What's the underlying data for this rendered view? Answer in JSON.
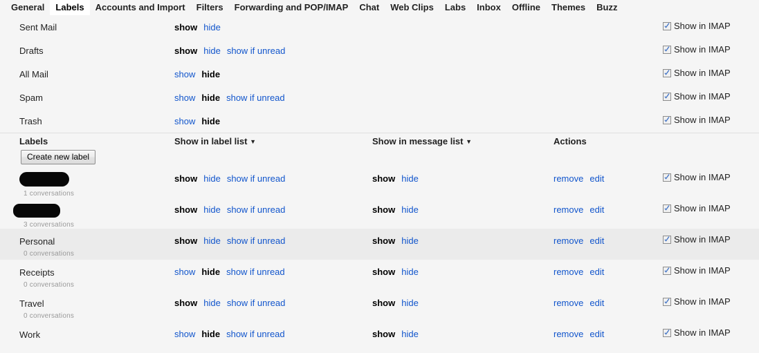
{
  "tabs": [
    {
      "label": "General",
      "active": false
    },
    {
      "label": "Labels",
      "active": true
    },
    {
      "label": "Accounts and Import",
      "active": false
    },
    {
      "label": "Filters",
      "active": false
    },
    {
      "label": "Forwarding and POP/IMAP",
      "active": false
    },
    {
      "label": "Chat",
      "active": false
    },
    {
      "label": "Web Clips",
      "active": false
    },
    {
      "label": "Labs",
      "active": false
    },
    {
      "label": "Inbox",
      "active": false
    },
    {
      "label": "Offline",
      "active": false
    },
    {
      "label": "Themes",
      "active": false
    },
    {
      "label": "Buzz",
      "active": false
    }
  ],
  "colors": {
    "link": "#1155cc",
    "page_background": "#f5f5f5",
    "row_highlight": "#ebebeb",
    "text": "#222222",
    "muted_text": "#999999",
    "checkbox_check": "#3b6fc4",
    "redaction": "#080808"
  },
  "system_labels": {
    "rows": [
      {
        "name": "Sent Mail",
        "label_list": [
          {
            "text": "show",
            "state": "selected"
          },
          {
            "text": "hide",
            "state": "link"
          }
        ],
        "imap": {
          "label": "Show in IMAP",
          "checked": true
        }
      },
      {
        "name": "Drafts",
        "label_list": [
          {
            "text": "show",
            "state": "selected"
          },
          {
            "text": "hide",
            "state": "link"
          },
          {
            "text": "show if unread",
            "state": "link"
          }
        ],
        "imap": {
          "label": "Show in IMAP",
          "checked": true
        }
      },
      {
        "name": "All Mail",
        "label_list": [
          {
            "text": "show",
            "state": "link"
          },
          {
            "text": "hide",
            "state": "selected"
          }
        ],
        "imap": {
          "label": "Show in IMAP",
          "checked": true
        }
      },
      {
        "name": "Spam",
        "label_list": [
          {
            "text": "show",
            "state": "link"
          },
          {
            "text": "hide",
            "state": "selected"
          },
          {
            "text": "show if unread",
            "state": "link"
          }
        ],
        "imap": {
          "label": "Show in IMAP",
          "checked": true
        }
      },
      {
        "name": "Trash",
        "label_list": [
          {
            "text": "show",
            "state": "link"
          },
          {
            "text": "hide",
            "state": "selected"
          }
        ],
        "imap": {
          "label": "Show in IMAP",
          "checked": true
        }
      }
    ]
  },
  "labels_section": {
    "headers": {
      "labels": "Labels",
      "show_in_label_list": "Show in label list",
      "show_in_message_list": "Show in message list",
      "actions": "Actions",
      "caret": "▼"
    },
    "create_button": "Create new label",
    "actions": {
      "remove": "remove",
      "edit": "edit"
    },
    "rows": [
      {
        "name": "",
        "redacted": true,
        "conversations": "1 conversations",
        "label_list": [
          {
            "text": "show",
            "state": "selected"
          },
          {
            "text": "hide",
            "state": "link"
          },
          {
            "text": "show if unread",
            "state": "link"
          }
        ],
        "message_list": [
          {
            "text": "show",
            "state": "selected"
          },
          {
            "text": "hide",
            "state": "link"
          }
        ],
        "imap": {
          "label": "Show in IMAP",
          "checked": true
        },
        "highlight": false
      },
      {
        "name": "",
        "redacted": true,
        "conversations": "3 conversations",
        "label_list": [
          {
            "text": "show",
            "state": "selected"
          },
          {
            "text": "hide",
            "state": "link"
          },
          {
            "text": "show if unread",
            "state": "link"
          }
        ],
        "message_list": [
          {
            "text": "show",
            "state": "selected"
          },
          {
            "text": "hide",
            "state": "link"
          }
        ],
        "imap": {
          "label": "Show in IMAP",
          "checked": true
        },
        "highlight": false
      },
      {
        "name": "Personal",
        "redacted": false,
        "conversations": "0 conversations",
        "label_list": [
          {
            "text": "show",
            "state": "selected"
          },
          {
            "text": "hide",
            "state": "link"
          },
          {
            "text": "show if unread",
            "state": "link"
          }
        ],
        "message_list": [
          {
            "text": "show",
            "state": "selected"
          },
          {
            "text": "hide",
            "state": "link"
          }
        ],
        "imap": {
          "label": "Show in IMAP",
          "checked": true
        },
        "highlight": true
      },
      {
        "name": "Receipts",
        "redacted": false,
        "conversations": "0 conversations",
        "label_list": [
          {
            "text": "show",
            "state": "link"
          },
          {
            "text": "hide",
            "state": "selected"
          },
          {
            "text": "show if unread",
            "state": "link"
          }
        ],
        "message_list": [
          {
            "text": "show",
            "state": "selected"
          },
          {
            "text": "hide",
            "state": "link"
          }
        ],
        "imap": {
          "label": "Show in IMAP",
          "checked": true
        },
        "highlight": false
      },
      {
        "name": "Travel",
        "redacted": false,
        "conversations": "0 conversations",
        "label_list": [
          {
            "text": "show",
            "state": "selected"
          },
          {
            "text": "hide",
            "state": "link"
          },
          {
            "text": "show if unread",
            "state": "link"
          }
        ],
        "message_list": [
          {
            "text": "show",
            "state": "selected"
          },
          {
            "text": "hide",
            "state": "link"
          }
        ],
        "imap": {
          "label": "Show in IMAP",
          "checked": true
        },
        "highlight": false
      },
      {
        "name": "Work",
        "redacted": false,
        "conversations": "",
        "label_list": [
          {
            "text": "show",
            "state": "link"
          },
          {
            "text": "hide",
            "state": "selected"
          },
          {
            "text": "show if unread",
            "state": "link"
          }
        ],
        "message_list": [
          {
            "text": "show",
            "state": "selected"
          },
          {
            "text": "hide",
            "state": "link"
          }
        ],
        "imap": {
          "label": "Show in IMAP",
          "checked": true
        },
        "highlight": false
      }
    ]
  }
}
